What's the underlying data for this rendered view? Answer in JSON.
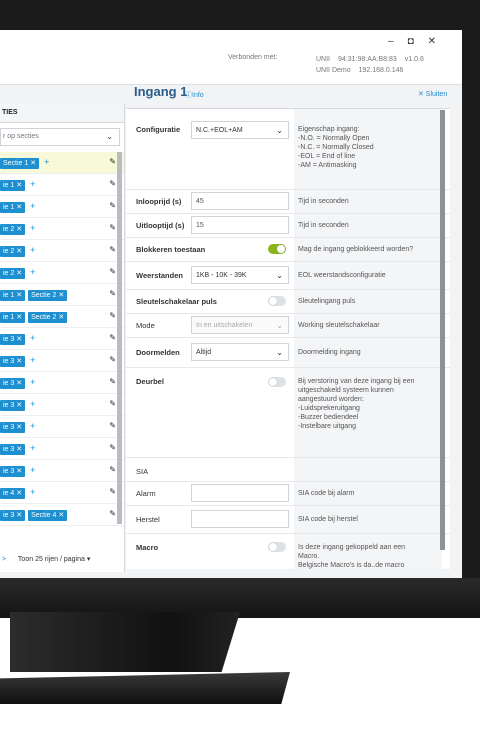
{
  "window": {
    "controls": [
      "–",
      "◘",
      "✕"
    ],
    "connected_label": "Verbonden met:",
    "unit_name": "UNII",
    "unit_mac": "94:31:98:AA:B8:83",
    "unit_version": "v1.0.6",
    "unit_demo": "UNII Demo",
    "unit_ip": "192.168.0.146"
  },
  "left": {
    "header": "TIES",
    "filter_placeholder": "r op secties",
    "rows": [
      {
        "tags": [
          "Sectie 1 ✕"
        ],
        "plus": "+",
        "selected": true
      },
      {
        "tags": [
          "ie 1 ✕"
        ],
        "plus": "+"
      },
      {
        "tags": [
          "ie 1 ✕"
        ],
        "plus": "+"
      },
      {
        "tags": [
          "ie 2 ✕"
        ],
        "plus": "+"
      },
      {
        "tags": [
          "ie 2 ✕"
        ],
        "plus": "+"
      },
      {
        "tags": [
          "ie 2 ✕"
        ],
        "plus": "+"
      },
      {
        "tags": [
          "ie 1 ✕",
          "Sectie 2 ✕"
        ],
        "plus": ""
      },
      {
        "tags": [
          "ie 1 ✕",
          "Sectie 2 ✕"
        ],
        "plus": ""
      },
      {
        "tags": [
          "ie 3 ✕"
        ],
        "plus": "+"
      },
      {
        "tags": [
          "ie 3 ✕"
        ],
        "plus": "+"
      },
      {
        "tags": [
          "ie 3 ✕"
        ],
        "plus": "+"
      },
      {
        "tags": [
          "ie 3 ✕"
        ],
        "plus": "+"
      },
      {
        "tags": [
          "ie 3 ✕"
        ],
        "plus": "+"
      },
      {
        "tags": [
          "ie 3 ✕"
        ],
        "plus": "+"
      },
      {
        "tags": [
          "ie 3 ✕"
        ],
        "plus": "+"
      },
      {
        "tags": [
          "ie 4 ✕"
        ],
        "plus": "+"
      },
      {
        "tags": [
          "ie 3 ✕",
          "Sectie 4 ✕"
        ],
        "plus": ""
      }
    ],
    "footer_next": ">",
    "footer_show": "Toon",
    "footer_per_page": "25 rijen / pagina"
  },
  "main": {
    "title": "Ingang 1",
    "info_link": "Info",
    "close_link": "✕ Sluiten",
    "fields": {
      "configuratie_label": "Configuratie",
      "configuratie_value": "N.C.+EOL+AM",
      "configuratie_desc": [
        "Eigenschap ingang:",
        "-N.O. = Normally Open",
        "-N.C. = Normally Closed",
        "-EOL = End of line",
        "-AM = Antimasking"
      ],
      "inloop_label": "Inlooprijd (s)",
      "inloop_value": "45",
      "inloop_desc": "Tijd in seconden",
      "uitloop_label": "Uitlooptijd (s)",
      "uitloop_value": "15",
      "uitloop_desc": "Tijd in seconden",
      "blokkeren_label": "Blokkeren toestaan",
      "blokkeren_desc": "Mag de ingang geblokkeerd worden?",
      "weerstanden_label": "Weerstanden",
      "weerstanden_value": "1KB - 10K - 39K",
      "weerstanden_desc": "EOL weerstandsconfiguratie",
      "sleutel_label": "Sleutelschakelaar puls",
      "sleutel_desc": "Sleutelingang puls",
      "mode_label": "Mode",
      "mode_value": "In en uitschakelen",
      "mode_desc": "Working sleutelschakelaar",
      "doormelden_label": "Doormelden",
      "doormelden_value": "Altijd",
      "doormelden_desc": "Doormelding ingang",
      "deurbel_label": "Deurbel",
      "deurbel_desc": [
        "Bij verstoring van deze ingang bij een",
        "uitgeschakeld systeem kunnen",
        "aangestuurd worden:",
        "-Luidsprekeruitgang",
        "-Buzzer bediendeel",
        "-Instelbare uitgang"
      ],
      "sia_label": "SIA",
      "alarm_label": "Alarm",
      "alarm_desc": "SIA code bij alarm",
      "herstel_label": "Herstel",
      "herstel_desc": "SIA code bij herstel",
      "macro_label": "Macro",
      "macro_desc": [
        "Is deze ingang gekoppeld aan een",
        "Macro.",
        "Belgische Macro's is da..de macro"
      ]
    },
    "toggles": {
      "blokkeren": true,
      "sleutel": false,
      "deurbel": false,
      "macro": false
    }
  }
}
